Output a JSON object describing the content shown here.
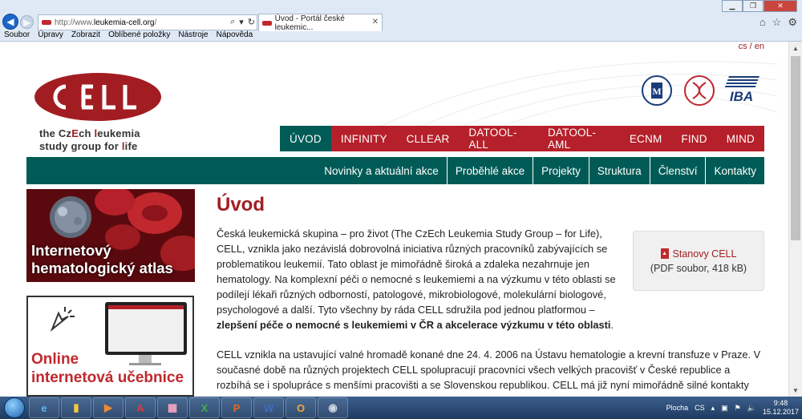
{
  "browser": {
    "url_prefix": "http://www.",
    "url_domain": "leukemia-cell.org",
    "url_suffix": "/",
    "tab_title": "Úvod - Portál české leukemic...",
    "menu": [
      "Soubor",
      "Úpravy",
      "Zobrazit",
      "Oblíbené položky",
      "Nástroje",
      "Nápověda"
    ]
  },
  "site": {
    "lang": "cs / en",
    "logo_line1_pre": "the Cz",
    "logo_line1_e": "E",
    "logo_line1_mid": "ch ",
    "logo_line1_l": "l",
    "logo_line1_post": "eukemia",
    "logo_line2_pre": "study group for ",
    "logo_line2_l": "l",
    "logo_line2_post": "ife",
    "partner_iba": "IBA",
    "main_menu": [
      "ÚVOD",
      "INFINITY",
      "CLLEAR",
      "DATOOL-ALL",
      "DATOOL-AML",
      "ECNM",
      "FIND",
      "MIND"
    ],
    "sub_menu": [
      "Novinky a aktuální akce",
      "Proběhlé akce",
      "Projekty",
      "Struktura",
      "Členství",
      "Kontakty"
    ]
  },
  "sidebar": {
    "atlas_line1": "Internetový",
    "atlas_line2": "hematologický atlas",
    "ucebnice_line1": "Online",
    "ucebnice_line2": "internetová učebnice"
  },
  "main": {
    "title": "Úvod",
    "p1_text": "Česká leukemická skupina – pro život (The CzEch Leukemia Study Group – for Life), CELL, vznikla jako nezávislá dobrovolná iniciativa různých pracovníků zabývajících se problematikou leukemií. Tato oblast je mimořádně široká a zdaleka nezahrnuje jen hematology. Na komplexní péči o nemocné s leukemiemi a na výzkumu v této oblasti se podílejí lékaři různých odborností, patologové, mikrobiologové, molekulární biologové, psychologové a další. Tyto všechny by ráda CELL sdružila pod jednou platformou – ",
    "p1_bold": "zlepšení péče o nemocné s leukemiemi v ČR a akcelerace výzkumu v této oblasti",
    "p1_end": ".",
    "p2": "CELL vznikla na ustavující valné hromadě konané dne 24. 4. 2006 na Ústavu hematologie a krevní transfuze v Praze. V současné době na různých projektech CELL spolupracují pracovníci všech velkých pracovišť v České republice a rozbíhá se i spolupráce s menšími pracovišti a se Slovenskou republikou. CELL má již nyní mimořádně silné kontakty",
    "pdf_link": "Stanovy CELL",
    "pdf_meta": "(PDF soubor, 418 kB)"
  },
  "taskbar": {
    "desktop": "Plocha",
    "lang": "CS",
    "time": "9:48",
    "date": "15.12.2017"
  }
}
